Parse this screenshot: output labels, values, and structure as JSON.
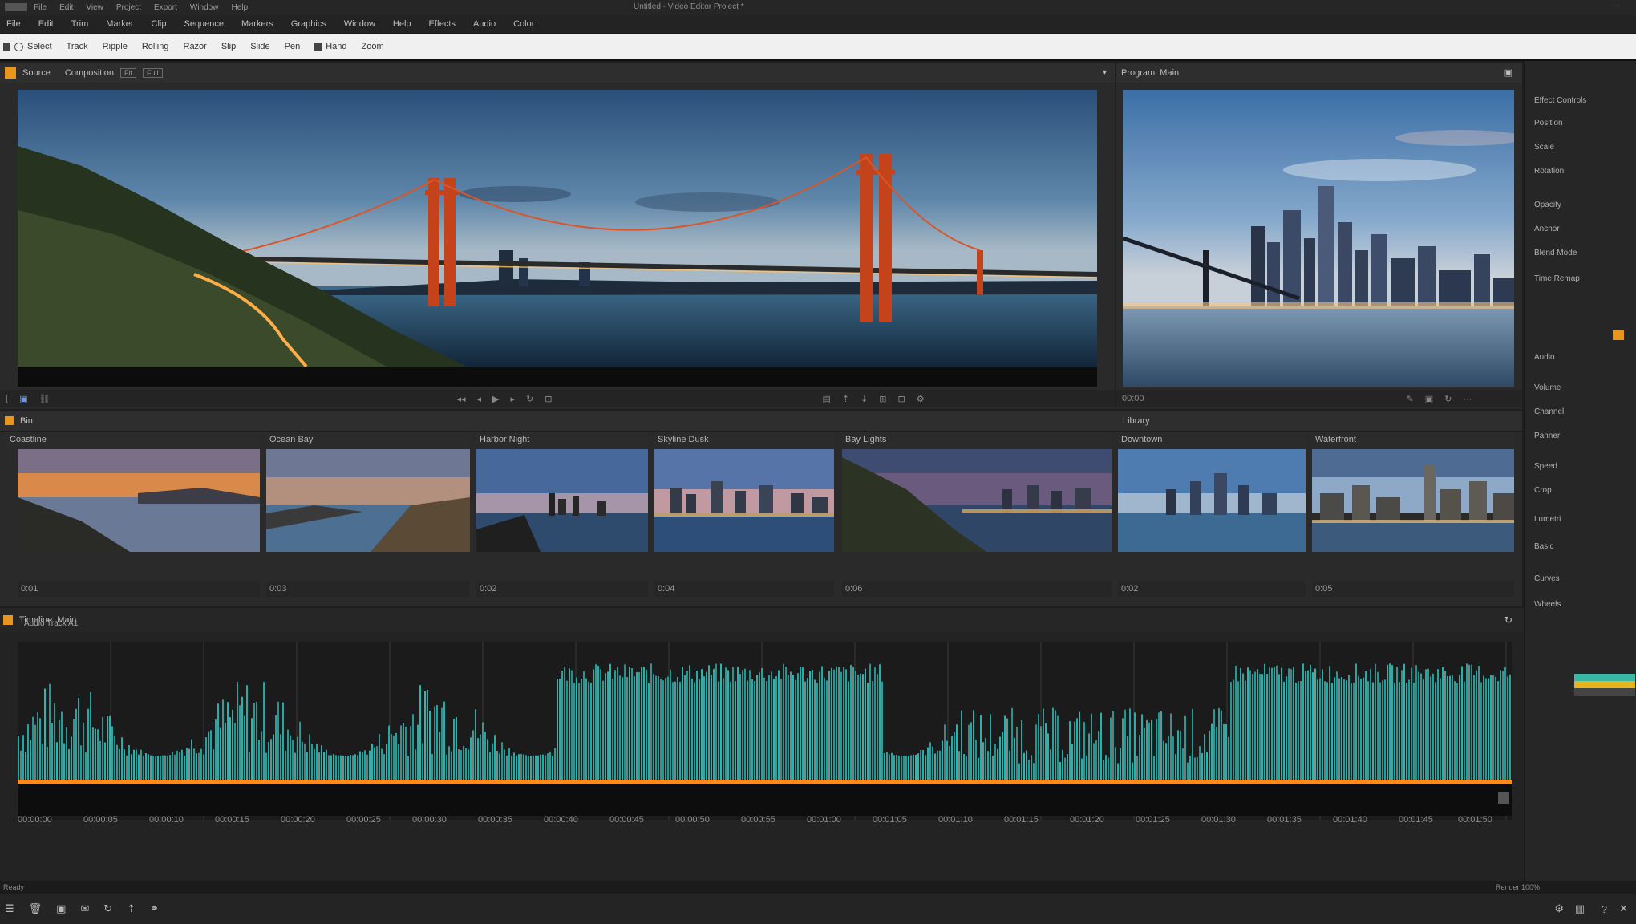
{
  "titlebar": {
    "items": [
      "File",
      "Edit",
      "View",
      "Project",
      "Export",
      "Window",
      "Help"
    ],
    "doc_title": "Untitled - Video Editor Project *",
    "controls": "—"
  },
  "menubar": {
    "items": [
      "File",
      "Edit",
      "Trim",
      "Marker",
      "Clip",
      "Sequence",
      "Markers",
      "Graphics",
      "Window",
      "Help",
      "Effects",
      "Audio",
      "Color"
    ]
  },
  "toolstrip": {
    "items": [
      "Select",
      "Track",
      "Ripple",
      "Rolling",
      "Razor",
      "Slip",
      "Slide",
      "Pen",
      "Hand",
      "Zoom"
    ]
  },
  "source_panel": {
    "tab_label": "Source",
    "title": "Composition",
    "buttons": [
      "Fit",
      "Full"
    ]
  },
  "program_panel": {
    "title": "Program: Main"
  },
  "media_bin": {
    "title": "Bin",
    "subtitle": "Library"
  },
  "thumbnails": [
    {
      "title": "Coastline",
      "footer": "0:01"
    },
    {
      "title": "Ocean Bay",
      "footer": "0:03"
    },
    {
      "title": "Harbor Night",
      "footer": "0:02"
    },
    {
      "title": "Skyline Dusk",
      "footer": "0:04"
    },
    {
      "title": "Bay Lights",
      "footer": "0:06"
    },
    {
      "title": "Downtown",
      "footer": "0:02"
    },
    {
      "title": "Waterfront",
      "footer": "0:05"
    }
  ],
  "timeline": {
    "title": "Timeline: Main",
    "track_label": "Audio Track A1"
  },
  "ruler_ticks": [
    "00:00:00",
    "00:00:05",
    "00:00:10",
    "00:00:15",
    "00:00:20",
    "00:00:25",
    "00:00:30",
    "00:00:35",
    "00:00:40",
    "00:00:45",
    "00:00:50",
    "00:00:55",
    "00:01:00",
    "00:01:05",
    "00:01:10",
    "00:01:15",
    "00:01:20",
    "00:01:25",
    "00:01:30",
    "00:01:35",
    "00:01:40",
    "00:01:45",
    "00:01:50"
  ],
  "sidebar": {
    "items": [
      "Effect Controls",
      "Position",
      "Scale",
      "Rotation",
      "Opacity",
      "Anchor",
      "Blend Mode",
      "Time Remap",
      "Audio",
      "Volume",
      "Channel",
      "Panner",
      "Speed",
      "Crop",
      "Lumetri",
      "Basic",
      "Curves",
      "Wheels"
    ]
  },
  "status": {
    "left": "Ready",
    "right": "Render 100%"
  },
  "colors": {
    "accent": "#e8961c",
    "waveform": "#2bb8b3",
    "playhead_line": "#ff8a1f"
  }
}
